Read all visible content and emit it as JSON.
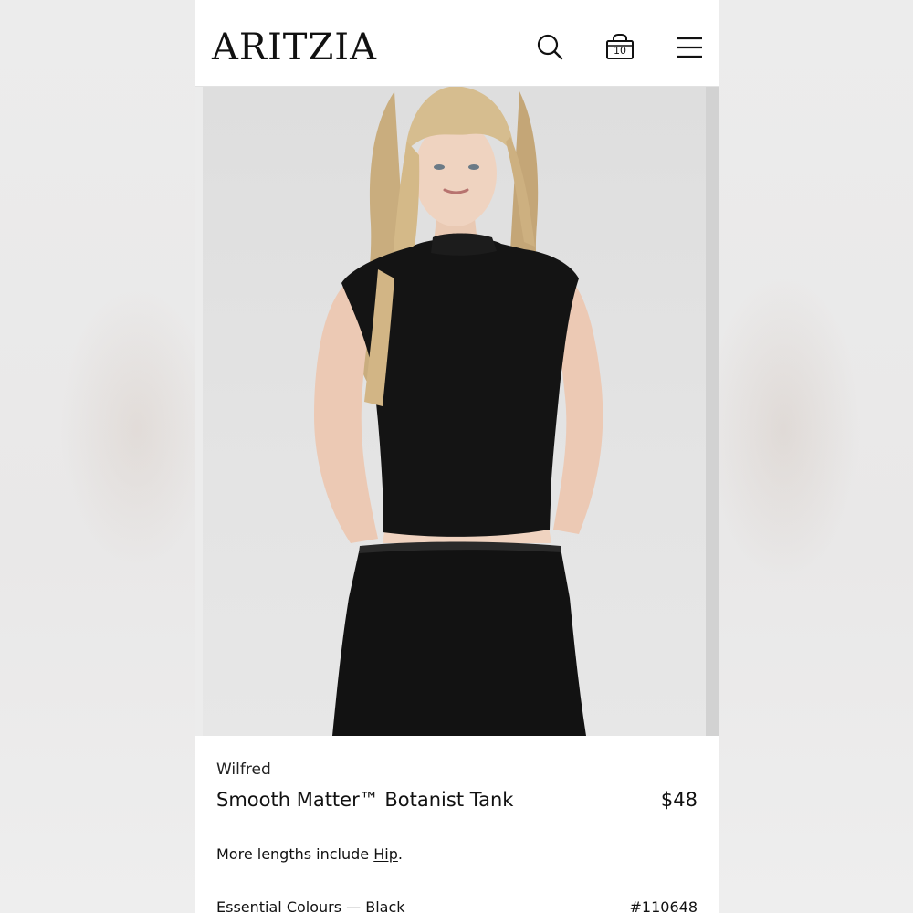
{
  "header": {
    "logo": "ARITZIA",
    "cart_count": "10",
    "icons": {
      "search": "search-icon",
      "cart": "shopping-bag-icon",
      "menu": "hamburger-menu-icon"
    }
  },
  "product": {
    "image": "product-photo",
    "brand": "Wilfred",
    "name": "Smooth Matter™ Botanist Tank",
    "price": "$48",
    "lengths_text": "More lengths include ",
    "lengths_link": "Hip",
    "lengths_suffix": ".",
    "colour": "Essential Colours — Black",
    "sku": "#110648"
  },
  "colors": {
    "background": "#f6f5f5",
    "text": "#111111",
    "garment": "#111111"
  }
}
